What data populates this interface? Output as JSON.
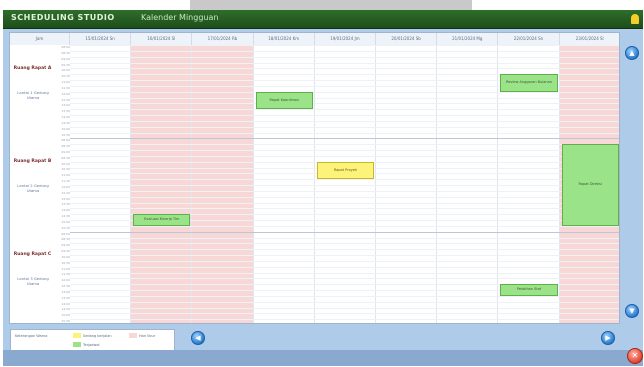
{
  "window": {
    "title": "SCHEDULING STUDIO",
    "subtitle": "Kalender Mingguan"
  },
  "grid": {
    "corner_label": "Jam",
    "days": [
      {
        "label": "15/01/2024 Sn",
        "closed": false
      },
      {
        "label": "16/01/2024 Sl",
        "closed": true
      },
      {
        "label": "17/01/2024 Rb",
        "closed": true
      },
      {
        "label": "18/01/2024 Km",
        "closed": false
      },
      {
        "label": "19/01/2024 Jm",
        "closed": false
      },
      {
        "label": "20/01/2024 Sb",
        "closed": false
      },
      {
        "label": "21/01/2024 Mg",
        "closed": false
      },
      {
        "label": "22/01/2024 Sn",
        "closed": false
      },
      {
        "label": "23/01/2024 Sl",
        "closed": true
      }
    ],
    "rooms": [
      {
        "name": "Ruang Rapat A",
        "sub": "Lantai 1 Gedung Utama"
      },
      {
        "name": "Ruang Rapat B",
        "sub": "Lantai 2 Gedung Utama"
      },
      {
        "name": "Ruang Rapat C",
        "sub": "Lantai 3 Gedung Utama"
      }
    ],
    "times": [
      "08:00",
      "08:30",
      "09:00",
      "09:30",
      "10:00",
      "10:30",
      "11:00",
      "11:30",
      "12:00",
      "12:30",
      "13:00",
      "13:30",
      "14:00",
      "14:30",
      "15:00",
      "15:30"
    ]
  },
  "events": [
    {
      "label": "Rapat Koordinasi",
      "day": 3,
      "room": 0,
      "start": 8,
      "span": 3,
      "color": "green"
    },
    {
      "label": "Review Anggaran Bulanan",
      "day": 7,
      "room": 0,
      "start": 5,
      "span": 3,
      "color": "green"
    },
    {
      "label": "Rapat Proyek",
      "day": 4,
      "room": 1,
      "start": 4,
      "span": 3,
      "color": "yellow"
    },
    {
      "label": "Rapat Direksi",
      "day": 8,
      "room": 1,
      "start": 1,
      "span": 14,
      "color": "green"
    },
    {
      "label": "Evaluasi Kinerja Tim",
      "day": 1,
      "room": 1,
      "start": 13,
      "span": 2,
      "color": "green"
    },
    {
      "label": "Pelatihan Staf",
      "day": 7,
      "room": 2,
      "start": 9,
      "span": 2,
      "color": "green"
    }
  ],
  "legend": {
    "title": "Keterangan Warna",
    "items": [
      {
        "label": "Sedang berjalan",
        "color": "#fbf37a"
      },
      {
        "label": "Terjadwal",
        "color": "#9be388"
      },
      {
        "label": "Hari libur",
        "color": "#f8d8d6"
      }
    ]
  },
  "nav": {
    "prev": "◀",
    "next": "▶",
    "up": "▲",
    "down": "▼",
    "close": "✕"
  },
  "colors": {
    "titlebar": "#2f6e2a",
    "closed_day": "#f8d8d6",
    "event_green": "#9be388",
    "event_yellow": "#fbf37a",
    "window_bg": "#aecbea"
  }
}
